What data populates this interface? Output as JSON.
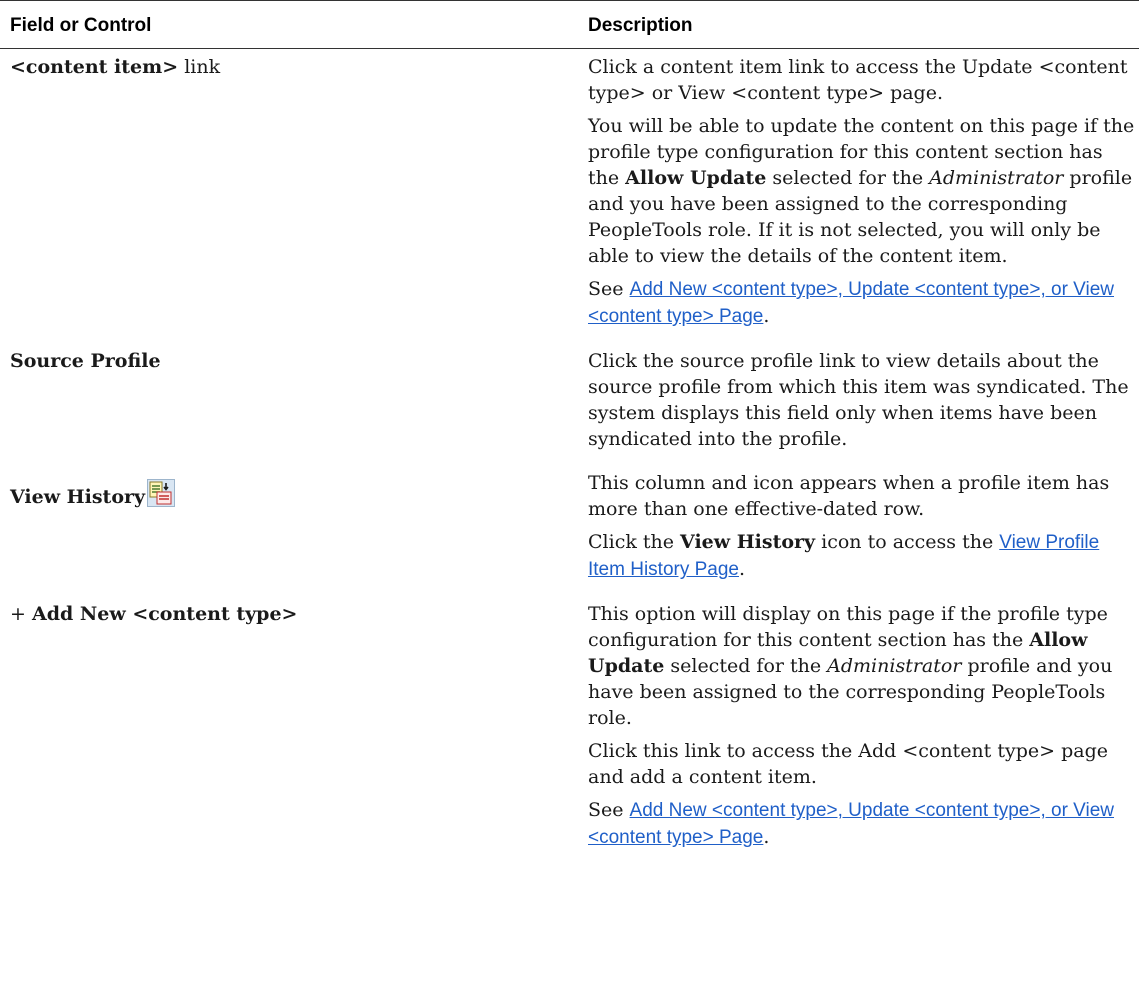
{
  "headers": {
    "field": "Field or Control",
    "description": "Description"
  },
  "rows": {
    "r0": {
      "field_bold": "<content item>",
      "field_rest": " link",
      "p1": "Click a content item link to access the Update <content type> or View <content type> page.",
      "p2_a": "You will be able to update the content on this page if the profile type configuration for this content section has the ",
      "p2_b": "Allow Update",
      "p2_c": " selected for the ",
      "p2_d": "Administrator",
      "p2_e": " profile and you have been assigned to the corresponding PeopleTools role. If it is not selected, you will only be able to view the details of the content item.",
      "p3_a": "See ",
      "p3_link": "Add New <content type>, Update <content type>, or View <content type> Page",
      "p3_b": "."
    },
    "r1": {
      "field": "Source Profile",
      "p1": "Click the source profile link to view details about the source profile from which this item was syndicated. The system displays this field only when items have been syndicated into the profile."
    },
    "r2": {
      "field": "View History",
      "icon": "view-history-icon",
      "p1": "This column and icon appears when a profile item has more than one effective-dated row.",
      "p2_a": "Click the ",
      "p2_b": "View History",
      "p2_c": " icon to access the ",
      "p2_link": "View Profile Item History Page",
      "p2_d": "."
    },
    "r3": {
      "field_prefix": "+ ",
      "field_bold": "Add New <content type>",
      "p1_a": "This option will display on this page if the profile type configuration for this content section has the ",
      "p1_b": "Allow Update",
      "p1_c": " selected for the ",
      "p1_d": "Administrator",
      "p1_e": " profile and you have been assigned to the corresponding PeopleTools role.",
      "p2": "Click this link to access the Add <content type> page and add a content item.",
      "p3_a": "See ",
      "p3_link": "Add New <content type>, Update <content type>, or View <content type> Page",
      "p3_b": "."
    }
  },
  "colors": {
    "link": "#1f5fc8",
    "rule": "#333333"
  }
}
